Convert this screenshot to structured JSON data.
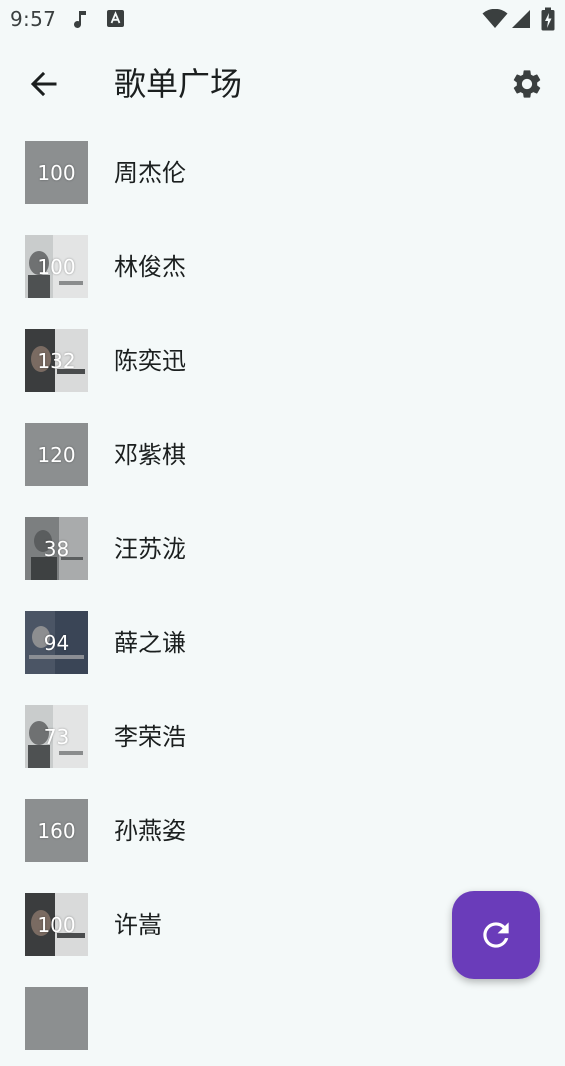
{
  "status_bar": {
    "time": "9:57",
    "icons": [
      "music-note-icon",
      "text-a-icon",
      "wifi-icon",
      "signal-icon",
      "battery-charging-icon"
    ]
  },
  "app_bar": {
    "title": "歌单广场",
    "back_icon": "arrow-left-icon",
    "settings_icon": "gear-icon"
  },
  "playlists": [
    {
      "count": "100",
      "name": "周杰伦",
      "thumb": "plain"
    },
    {
      "count": "100",
      "name": "林俊杰",
      "thumb": "photo-light"
    },
    {
      "count": "132",
      "name": "陈奕迅",
      "thumb": "photo-dark"
    },
    {
      "count": "120",
      "name": "邓紫棋",
      "thumb": "plain"
    },
    {
      "count": "38",
      "name": "汪苏泷",
      "thumb": "photo-mid"
    },
    {
      "count": "94",
      "name": "薛之谦",
      "thumb": "photo-blue"
    },
    {
      "count": "73",
      "name": "李荣浩",
      "thumb": "photo-light"
    },
    {
      "count": "160",
      "name": "孙燕姿",
      "thumb": "plain"
    },
    {
      "count": "100",
      "name": "许嵩",
      "thumb": "photo-dark"
    },
    {
      "count": "",
      "name": "",
      "thumb": "plain"
    }
  ],
  "fab": {
    "icon": "refresh-icon",
    "color": "#6a3cba"
  },
  "colors": {
    "background": "#f4f9f9",
    "thumb_placeholder": "#8c8f90"
  }
}
